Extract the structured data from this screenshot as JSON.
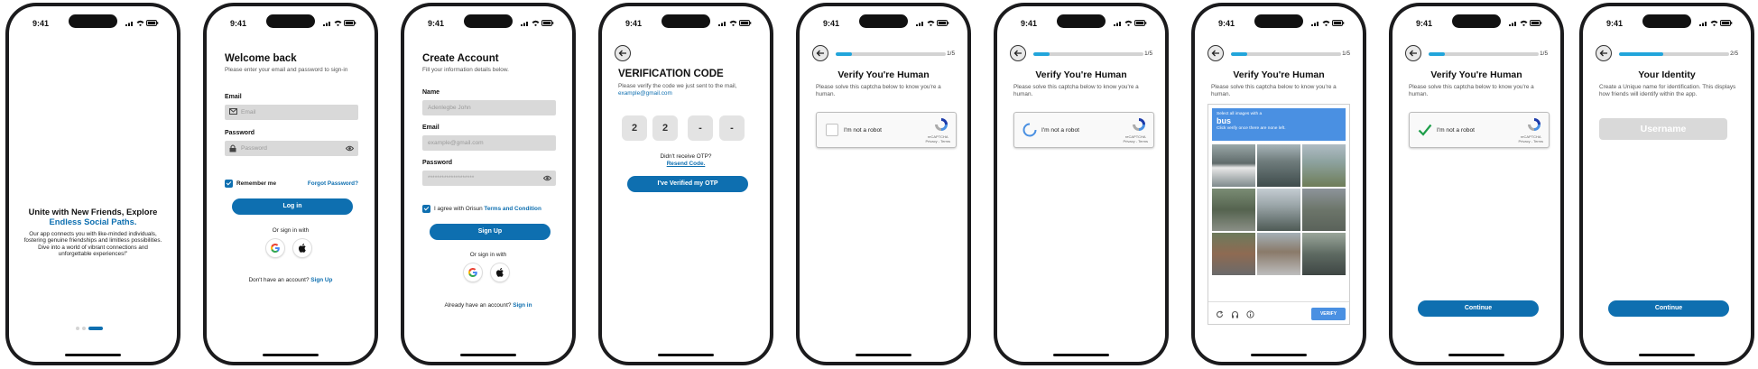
{
  "status": {
    "time": "9:41"
  },
  "onboarding": {
    "headline_1": "Unite with New Friends, Explore",
    "headline_2": "Endless Social Paths.",
    "body": "Our app connects you with like-minded individuals, fostering genuine friendships and limitless possibilities. Dive into a world of vibrant connections and unforgettable experiences!\"",
    "active_page": 3,
    "page_count": 3
  },
  "login": {
    "title": "Welcome back",
    "subtitle": "Please enter your email and password to sign-in",
    "email_label": "Email",
    "email_placeholder": "Email",
    "password_label": "Password",
    "password_placeholder": "Password",
    "remember": "Remember me",
    "forgot": "Forgot Password?",
    "button": "Log in",
    "or": "Or sign in with",
    "no_account": "Don't have an account?",
    "signup_link": "Sign Up"
  },
  "signup": {
    "title": "Create Account",
    "subtitle": "Fill your information details below.",
    "name_label": "Name",
    "name_placeholder": "Adenlegbe John",
    "email_label": "Email",
    "email_placeholder": "example@gmail.com",
    "password_label": "Password",
    "password_placeholder": "********************",
    "agree": "I agree with Orisun",
    "terms": "Terms and Condition",
    "button": "Sign Up",
    "or": "Or sign in with",
    "have_account": "Already have an account?",
    "signin_link": "Sign in"
  },
  "otp": {
    "title": "VERIFICATION CODE",
    "subtitle": "Please verify the code we just sent to the mail,",
    "email": "example@gmail.com",
    "digits": [
      "2",
      "2",
      "-",
      "-"
    ],
    "didnt": "Didn't receive OTP?",
    "resend": "Resend Code.",
    "button": "I've Verified my OTP"
  },
  "verify": {
    "title": "Verify You're Human",
    "subtitle": "Please solve this captcha below to know you're a human.",
    "step": "1/5",
    "progress": 0.15,
    "captcha_label": "I'm not a robot",
    "recaptcha": "reCAPTCHA",
    "privacy_terms": "Privacy - Terms",
    "continue": "Continue"
  },
  "image_challenge": {
    "line1": "Select all images with a",
    "object": "bus",
    "line2": "Click verify once there are none left.",
    "verify": "VERIFY"
  },
  "identity": {
    "title": "Your Identity",
    "subtitle": "Create a Unique name for identification. This displays how friends will identify within the app.",
    "step": "2/5",
    "progress": 0.4,
    "placeholder": "Username",
    "continue": "Continue"
  },
  "colors": {
    "brand": "#0e6fb0",
    "progress": "#22a5db",
    "field": "#d9d9d9"
  }
}
